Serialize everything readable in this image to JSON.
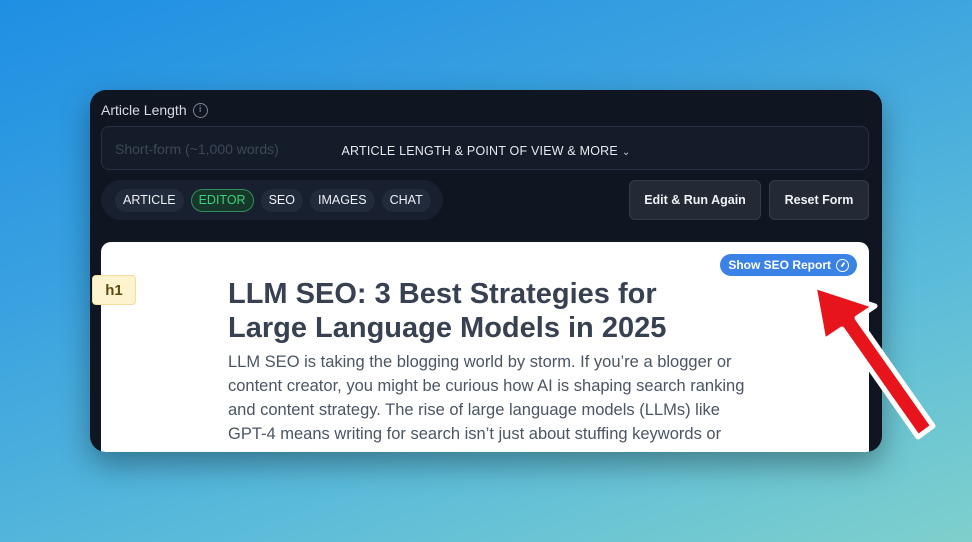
{
  "form": {
    "article_length_label": "Article Length",
    "info_icon": "info-icon",
    "article_length_value": "Short-form (~1,000 words)",
    "more_options_label": "ARTICLE LENGTH & POINT OF VIEW & MORE",
    "more_options_icon": "chevron-down-icon"
  },
  "tabs": [
    {
      "label": "ARTICLE",
      "active": false
    },
    {
      "label": "EDITOR",
      "active": true
    },
    {
      "label": "SEO",
      "active": false
    },
    {
      "label": "IMAGES",
      "active": false
    },
    {
      "label": "CHAT",
      "active": false
    }
  ],
  "actions": {
    "edit_run_again": "Edit & Run Again",
    "reset_form": "Reset Form"
  },
  "editor": {
    "seo_report_button": "Show SEO Report",
    "seo_report_icon": "gauge-icon",
    "heading_tag": "h1",
    "title": "LLM SEO: 3 Best Strategies for Large Language Models in 2025",
    "intro": "LLM SEO is taking the blogging world by storm. If you’re a blogger or content creator, you might be curious how AI is shaping search ranking and content strategy. The rise of large language models (LLMs) like GPT-4 means writing for search isn’t just about stuffing keywords or"
  },
  "colors": {
    "background_top": "#1f8fe3",
    "background_bottom": "#7fd0cc",
    "panel": "#0f1521",
    "active_tab": "#34d27b",
    "seo_button": "#3b82e6",
    "annotation_arrow": "#e8141c"
  }
}
